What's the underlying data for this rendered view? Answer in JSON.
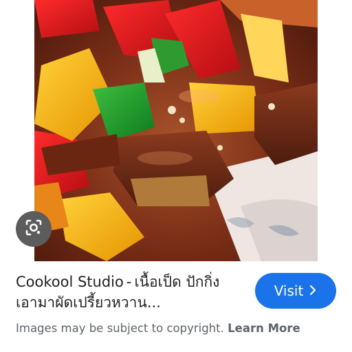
{
  "image": {
    "alt_description_icon": "food-photo"
  },
  "lens_button": {
    "icon": "lens-camera-icon"
  },
  "result": {
    "source": "Cookool Studio",
    "separator": "-",
    "title": "เนื้อเป็ด ปักกิ่ง เอามาผัดเปรี้ยวหวาน..."
  },
  "visit_button": {
    "label": "Visit",
    "icon": "chevron-right-icon"
  },
  "footer": {
    "notice": "Images may be subject to copyright.",
    "link": "Learn More"
  },
  "colors": {
    "accent": "#1a73e8",
    "title_text": "#202124",
    "secondary_text": "#5f6368",
    "lens_bg": "#5c5c5c"
  }
}
